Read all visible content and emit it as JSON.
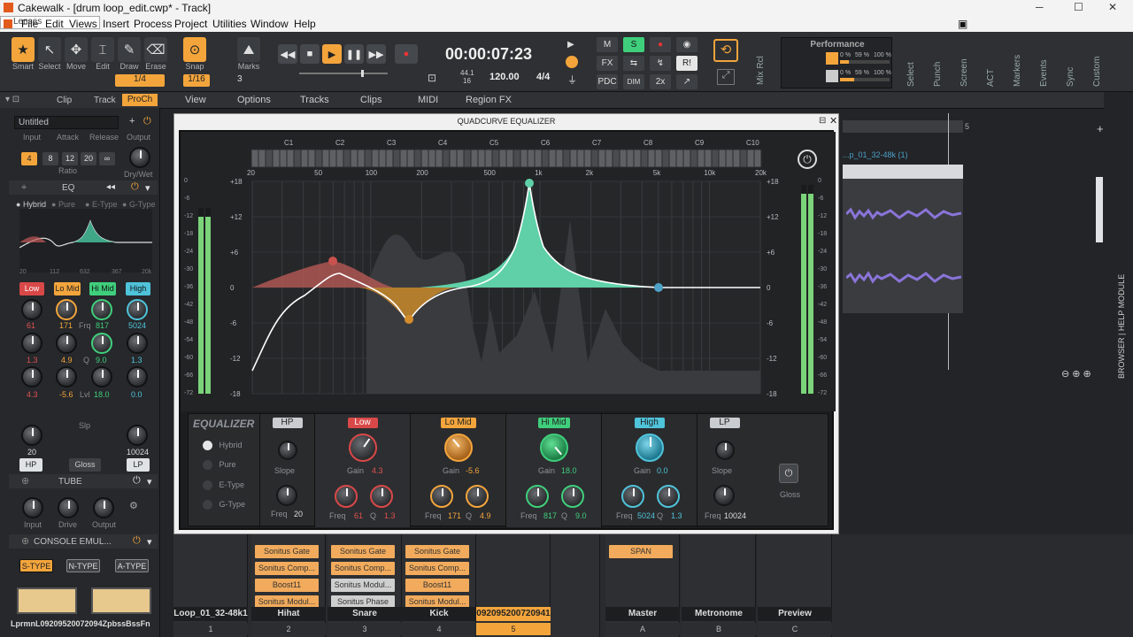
{
  "window": {
    "title": "Cakewalk - [drum loop_edit.cwp* - Track]",
    "minimize": "─",
    "maximize": "☐",
    "close": "✕"
  },
  "menu": {
    "items": [
      "File",
      "Edit",
      "Views",
      "Insert",
      "Process",
      "Project",
      "Utilities",
      "Window",
      "Help"
    ],
    "lenses": "Lenses"
  },
  "tools": {
    "smart": "Smart",
    "select": "Select",
    "move": "Move",
    "edit": "Edit",
    "draw": "Draw",
    "erase": "Erase",
    "snap": "Snap",
    "marks": "Marks",
    "snap_value": "1/4",
    "snap_value2": "1/16",
    "marks_value": "3"
  },
  "transport": {
    "time": "00:00:07:23",
    "sample_rate": "44.1",
    "bit_depth": "16",
    "tempo": "120.00",
    "meter": "4/4"
  },
  "mix": {
    "m": "M",
    "s": "S",
    "fx": "FX",
    "pdc": "PDC",
    "dim": "DIM",
    "twox": "2x",
    "ri": "R!"
  },
  "performance": {
    "title": "Performance",
    "cpu1": "0 %",
    "cpu2": "59 %",
    "cpu3": "100 %",
    "mem1": "0 %",
    "mem2": "59 %",
    "mem3": "100 %"
  },
  "right_vertical": [
    "Mix Rcl",
    "Select",
    "Punch",
    "Screen",
    "ACT",
    "Markers",
    "Events",
    "Sync",
    "Custom"
  ],
  "inspector": {
    "tabs": [
      "Clip",
      "Track",
      "ProCh"
    ],
    "preset": "Untitled",
    "comp_labels": [
      "Input",
      "Attack",
      "Release",
      "Output"
    ],
    "ratios": [
      "4",
      "8",
      "12",
      "20",
      "∞"
    ],
    "ratio_label": "Ratio",
    "drywet": "Dry/Wet",
    "eq_title": "EQ",
    "eq_modes": [
      "Hybrid",
      "Pure",
      "E-Type",
      "G-Type"
    ],
    "eq_ticks": [
      "20",
      "112",
      "632",
      "367",
      "20k"
    ],
    "bands": [
      "Low",
      "Lo Mid",
      "Hi Mid",
      "High"
    ],
    "freqs": [
      "61",
      "171",
      "817",
      "5024"
    ],
    "frq": "Frq",
    "qs": [
      "1.3",
      "4.9",
      "9.0",
      "1.3"
    ],
    "q": "Q",
    "gains": [
      "4.3",
      "-5.6",
      "18.0",
      "0.0"
    ],
    "lvl": "Lvl",
    "slp": "Slp",
    "hp_val": "20",
    "lp_val": "10024",
    "hp": "HP",
    "gloss": "Gloss",
    "lp": "LP",
    "tube": "TUBE",
    "tube_labels": [
      "Input",
      "Drive",
      "Output"
    ],
    "console": "CONSOLE EMUL...",
    "console_types": [
      "S-TYPE",
      "N-TYPE",
      "A-TYPE"
    ],
    "track_label": "LprmnL09209520072094ZpbssBssFn"
  },
  "trackview": {
    "menus": [
      "View",
      "Options",
      "Tracks",
      "Clips",
      "MIDI",
      "Region FX"
    ],
    "clip_label": "...p_01_32-48k (1)",
    "side": "BROWSER | HELP MODULE",
    "ruler_mark": "5"
  },
  "quadcurve": {
    "title": "QUADCURVE EQUALIZER",
    "pin": "⊟",
    "close": "✕",
    "notes": [
      "C1",
      "C2",
      "C3",
      "C4",
      "C5",
      "C6",
      "C7",
      "C8",
      "C9",
      "C10"
    ],
    "freq_ticks": [
      "20",
      "50",
      "100",
      "200",
      "500",
      "1k",
      "2k",
      "5k",
      "10k",
      "20k"
    ],
    "db_left": [
      "+18",
      "+12",
      "+6",
      "0",
      "-6",
      "-12",
      "-18"
    ],
    "db_meter": [
      "0",
      "-6",
      "-12",
      "-18",
      "-24",
      "-30",
      "-36",
      "-42",
      "-48",
      "-54",
      "-60",
      "-66",
      "-72"
    ],
    "section": "EQUALIZER",
    "modes": [
      "Hybrid",
      "Pure",
      "E-Type",
      "G-Type"
    ],
    "hp": {
      "label": "HP",
      "slope": "Slope",
      "freq": "Freq",
      "freq_val": "20"
    },
    "low": {
      "label": "Low",
      "gain": "Gain",
      "gain_val": "4.3",
      "freq": "Freq",
      "freq_val": "61",
      "q": "Q",
      "q_val": "1.3"
    },
    "lomid": {
      "label": "Lo Mid",
      "gain": "Gain",
      "gain_val": "-5.6",
      "freq": "Freq",
      "freq_val": "171",
      "q": "Q",
      "q_val": "4.9"
    },
    "himid": {
      "label": "Hi Mid",
      "gain": "Gain",
      "gain_val": "18.0",
      "freq": "Freq",
      "freq_val": "817",
      "q": "Q",
      "q_val": "9.0"
    },
    "high": {
      "label": "High",
      "gain": "Gain",
      "gain_val": "0.0",
      "freq": "Freq",
      "freq_val": "5024",
      "q": "Q",
      "q_val": "1.3"
    },
    "lp": {
      "label": "LP",
      "slope": "Slope",
      "freq": "Freq",
      "freq_val": "10024"
    },
    "gloss": "Gloss"
  },
  "mixer": {
    "strips": [
      {
        "name": "Loop_01_32-48k1",
        "num": "1",
        "fx": []
      },
      {
        "name": "Hihat",
        "num": "2",
        "fx": [
          "Sonitus Gate",
          "Sonitus Comp...",
          "Boost11",
          "Sonitus Modul..."
        ]
      },
      {
        "name": "Snare",
        "num": "3",
        "fx": [
          "Sonitus Gate",
          "Sonitus Comp...",
          "Sonitus Modul...",
          "Sonitus Phase"
        ]
      },
      {
        "name": "Kick",
        "num": "4",
        "fx": [
          "Sonitus Gate",
          "Sonitus Comp...",
          "Boost11",
          "Sonitus Modul..."
        ]
      },
      {
        "name": "092095200720941",
        "num": "5",
        "fx": []
      },
      {
        "name": "",
        "num": "",
        "fx": []
      },
      {
        "name": "Master",
        "num": "A",
        "fx": [
          "SPAN"
        ]
      },
      {
        "name": "Metronome",
        "num": "B",
        "fx": []
      },
      {
        "name": "Preview",
        "num": "C",
        "fx": []
      }
    ]
  }
}
